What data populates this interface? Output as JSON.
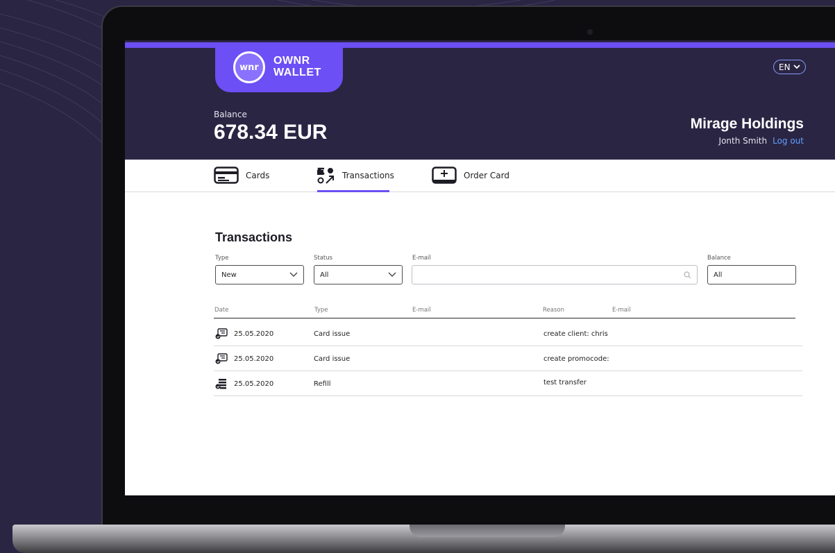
{
  "app": {
    "logo_mark": "wnr",
    "logo_line1": "OWNR",
    "logo_line2": "WALLET",
    "lang": "EN"
  },
  "header": {
    "balance_label": "Balance",
    "balance_value": "678.34 EUR",
    "company": "Mirage Holdings",
    "user": "Jonth Smith",
    "logout": "Log out"
  },
  "tabs": [
    {
      "label": "Cards",
      "icon": "card-icon"
    },
    {
      "label": "Transactions",
      "icon": "transfer-icon",
      "active": true
    },
    {
      "label": "Order Card",
      "icon": "add-card-icon"
    }
  ],
  "section": {
    "title": "Transactions"
  },
  "filters": {
    "type_label": "Type",
    "type_value": "New",
    "status_label": "Status",
    "status_value": "All",
    "email_label": "E-mail",
    "email_placeholder": "",
    "balance_label": "Balance",
    "balance_value": "All"
  },
  "table": {
    "columns": [
      "Date",
      "Type",
      "E-mail",
      "Reason",
      "E-mail"
    ],
    "rows": [
      {
        "icon": "card-issue-icon",
        "date": "25.05.2020",
        "type": "Card issue",
        "reason": "create client: chris"
      },
      {
        "icon": "card-issue-icon",
        "date": "25.05.2020",
        "type": "Card issue",
        "reason": "create promocode:"
      },
      {
        "icon": "refill-icon",
        "date": "25.05.2020",
        "type": "Refill",
        "reason": "test transfer"
      }
    ]
  },
  "colors": {
    "accent": "#6c4ff5",
    "header_bg": "#2a2543",
    "link": "#5fa0ff"
  }
}
